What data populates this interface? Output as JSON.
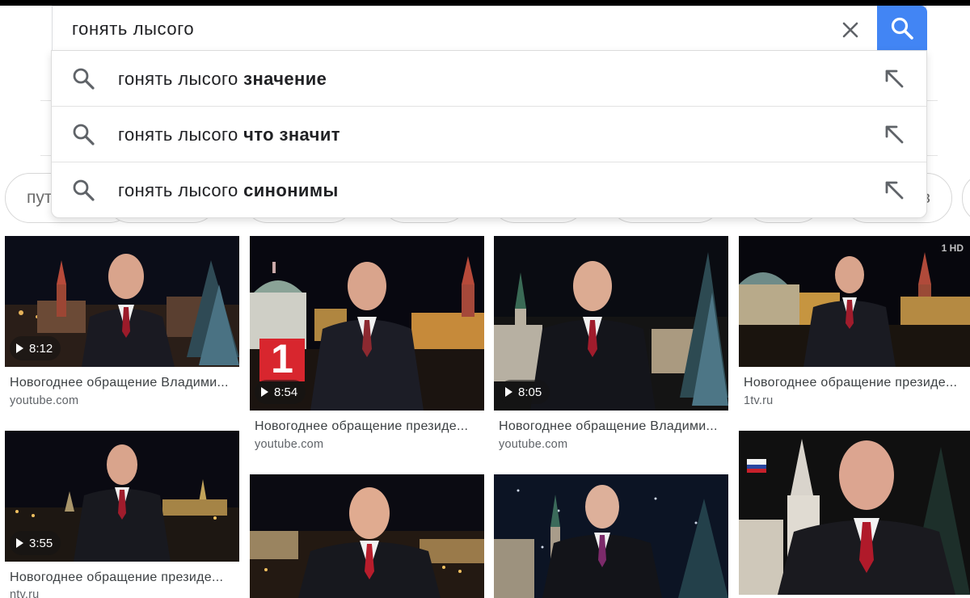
{
  "search": {
    "query": "гонять лысого"
  },
  "suggestions": [
    {
      "prefix": "гонять лысого ",
      "completion": "значение"
    },
    {
      "prefix": "гонять лысого ",
      "completion": "что значит"
    },
    {
      "prefix": "гонять лысого ",
      "completion": "синонимы"
    }
  ],
  "chips": [
    {
      "label": "пут"
    },
    {
      "label": ""
    },
    {
      "label": ""
    },
    {
      "label": ""
    },
    {
      "label": ""
    },
    {
      "label": ""
    },
    {
      "label": ""
    },
    {
      "label": "в"
    }
  ],
  "results": [
    {
      "caption": "Новогоднее обращение Владими...",
      "source": "youtube.com",
      "duration": "8:12"
    },
    {
      "caption": "Новогоднее обращение президе...",
      "source": "youtube.com",
      "duration": "8:54"
    },
    {
      "caption": "Новогоднее обращение Владими...",
      "source": "youtube.com",
      "duration": "8:05"
    },
    {
      "caption": "Новогоднее обращение президе...",
      "source": "1tv.ru",
      "duration": ""
    },
    {
      "caption": "Новогоднее обращение президе...",
      "source": "ntv.ru",
      "duration": "3:55"
    },
    {
      "caption": "",
      "source": "",
      "duration": ""
    },
    {
      "caption": "",
      "source": "",
      "duration": ""
    },
    {
      "caption": "",
      "source": "",
      "duration": ""
    }
  ],
  "logos": {
    "channel_one": "1",
    "watermark": "1 HD"
  },
  "colors": {
    "search_button": "#4285f4",
    "channel_logo": "#d8262e"
  },
  "icons": [
    "search-icon",
    "close-icon",
    "arrow-up-left-icon",
    "play-icon"
  ]
}
